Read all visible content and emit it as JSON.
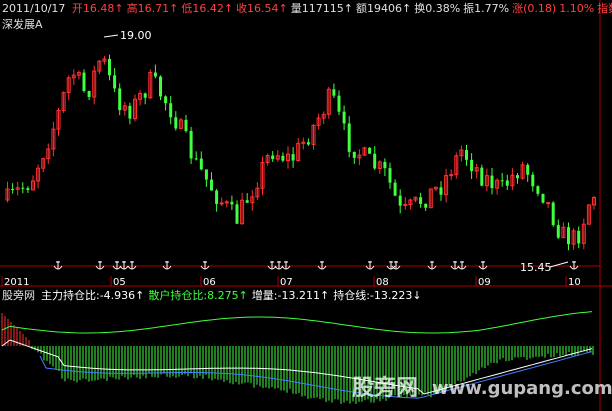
{
  "stock": {
    "name": "深发展A",
    "date": "2011/10/17",
    "quote": [
      {
        "label": "开",
        "value": "16.48",
        "arrow": "↑",
        "color": "#ff4040"
      },
      {
        "label": "高",
        "value": "16.71",
        "arrow": "↑",
        "color": "#ff4040"
      },
      {
        "label": "低",
        "value": "16.42",
        "arrow": "↑",
        "color": "#ff4040"
      },
      {
        "label": "收",
        "value": "16.54",
        "arrow": "↑",
        "color": "#ff4040"
      },
      {
        "label": "量",
        "value": "117115",
        "arrow": "↑",
        "color": "#e0e0e0"
      },
      {
        "label": "额",
        "value": "19406",
        "arrow": "↑",
        "color": "#e0e0e0"
      },
      {
        "label": "换",
        "value": "0.38%",
        "arrow": "",
        "color": "#e0e0e0"
      },
      {
        "label": "振",
        "value": "1.77%",
        "arrow": "",
        "color": "#e0e0e0"
      },
      {
        "label": "涨",
        "value": "(0.18)",
        "arrow": "",
        "color": "#ff4040"
      },
      {
        "label": "",
        "value": "1.10%",
        "arrow": "",
        "color": "#ff4040"
      },
      {
        "label": "",
        "value": "指数",
        "arrow": "",
        "color": "#ff4040"
      }
    ]
  },
  "price_annotations": {
    "high": "19.00",
    "low": "15.45"
  },
  "timeline": [
    "2011",
    "05",
    "06",
    "07",
    "08",
    "09",
    "10"
  ],
  "indicator": {
    "site": "股旁网",
    "items": [
      {
        "label": "主力持仓比",
        "value": "-4.936",
        "arrow": "↑",
        "color": "#ffffff"
      },
      {
        "label": "散户持仓比",
        "value": "8.275",
        "arrow": "↑",
        "color": "#40ff40"
      },
      {
        "label": "增量",
        "value": "-13.211",
        "arrow": "↑",
        "color": "#ffffff"
      },
      {
        "label": "持仓线",
        "value": "-13.223",
        "arrow": "↓",
        "color": "#ffffff"
      }
    ]
  },
  "watermark": {
    "cn": "股旁网",
    "url": "www.gupang.com"
  },
  "colors": {
    "up": "#ff3030",
    "down": "#40ff40",
    "axis": "#b00000",
    "text": "#e0e0e0"
  }
}
